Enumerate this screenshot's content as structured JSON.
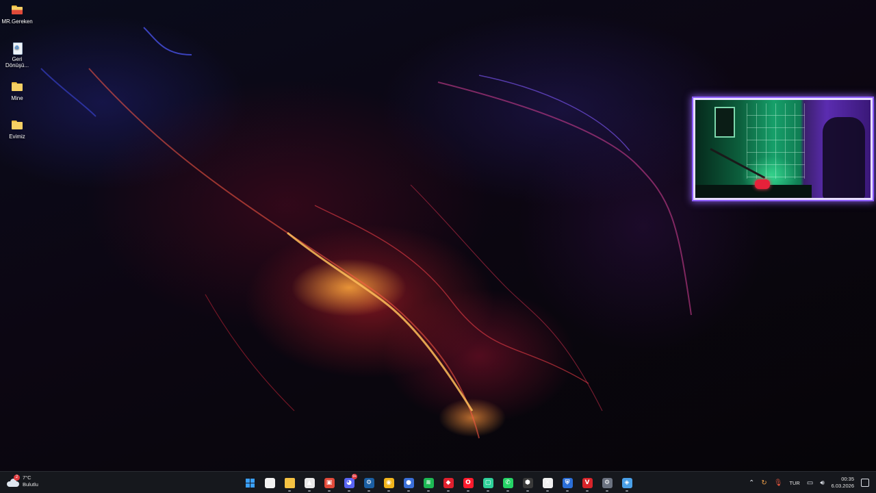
{
  "desktop": {
    "icons": [
      {
        "label": "MR.Gereken",
        "icon": "red-folder-icon"
      },
      {
        "label": "Geri Dönüşü...",
        "icon": "recycle-bin-icon"
      },
      {
        "label": "Mine",
        "icon": "folder-icon"
      },
      {
        "label": "Evimiz",
        "icon": "folder-icon"
      }
    ]
  },
  "taskbar": {
    "weather": {
      "temperature": "7°C",
      "condition": "Bulutlu",
      "badge": "2"
    },
    "apps": [
      {
        "name": "start",
        "icon": "windows-logo-icon",
        "glyph": "",
        "color": "#3aa0ff"
      },
      {
        "name": "microsoft-store",
        "icon": "store-icon",
        "glyph": "",
        "color": "#f2f2f2"
      },
      {
        "name": "file-explorer",
        "icon": "folder-icon",
        "glyph": "",
        "color": "#f6c343"
      },
      {
        "name": "app-4",
        "icon": "triangle-app-icon",
        "glyph": "▲",
        "color": "#e9e9e9"
      },
      {
        "name": "app-5",
        "icon": "photo-editor-icon",
        "glyph": "▣",
        "color": "#e24a3a"
      },
      {
        "name": "discord",
        "icon": "discord-icon",
        "glyph": "◕",
        "color": "#5865f2",
        "badge": "9+"
      },
      {
        "name": "steam",
        "icon": "steam-icon",
        "glyph": "⚙",
        "color": "#1b5fa3"
      },
      {
        "name": "chrome",
        "icon": "chrome-icon",
        "glyph": "◉",
        "color": "#f2b51c"
      },
      {
        "name": "app-9",
        "icon": "blue-orb-icon",
        "glyph": "●",
        "color": "#3a6fd8"
      },
      {
        "name": "spotify",
        "icon": "spotify-icon",
        "glyph": "≋",
        "color": "#1db954"
      },
      {
        "name": "app-11",
        "icon": "red-app-icon",
        "glyph": "◆",
        "color": "#e0202e"
      },
      {
        "name": "opera",
        "icon": "opera-icon",
        "glyph": "O",
        "color": "#ff1b2d"
      },
      {
        "name": "app-13",
        "icon": "green-app-icon",
        "glyph": "▢",
        "color": "#2fd19a"
      },
      {
        "name": "whatsapp",
        "icon": "whatsapp-icon",
        "glyph": "✆",
        "color": "#25d366"
      },
      {
        "name": "app-15",
        "icon": "hexagon-app-icon",
        "glyph": "⬢",
        "color": "#3a3a3a"
      },
      {
        "name": "capcut",
        "icon": "capcut-icon",
        "glyph": "✕",
        "color": "#f0f0f0"
      },
      {
        "name": "app-17",
        "icon": "shield-app-icon",
        "glyph": "⛨",
        "color": "#2b6fd8"
      },
      {
        "name": "voicemod",
        "icon": "voice-app-icon",
        "glyph": "V",
        "color": "#d8242a"
      },
      {
        "name": "settings",
        "icon": "gear-icon",
        "glyph": "⚙",
        "color": "#6b7280"
      },
      {
        "name": "app-20",
        "icon": "diamond-app-icon",
        "glyph": "◈",
        "color": "#4aa0e8"
      }
    ],
    "tray": {
      "language": "TUR",
      "time": "00:35",
      "date": "6.03.2026"
    }
  }
}
